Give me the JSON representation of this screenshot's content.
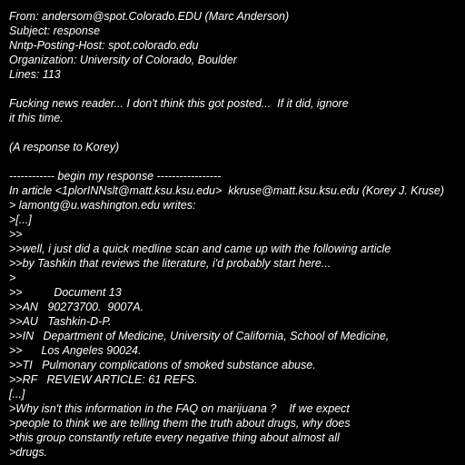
{
  "header": {
    "from": "From: andersom@spot.Colorado.EDU (Marc Anderson)",
    "subject": "Subject: response",
    "nntp_host": "Nntp-Posting-Host: spot.colorado.edu",
    "organization": "Organization: University of Colorado, Boulder",
    "lines": "Lines: 113"
  },
  "body": {
    "intro_1": "Fucking news reader... I don't think this got posted...  If it did, ignore",
    "intro_2": "it this time.",
    "intro_3": "(A response to Korey)",
    "begin": "------------ begin my response -----------------",
    "article": "In article <1plorINNslt@matt.ksu.ksu.edu>  kkruse@matt.ksu.ksu.edu (Korey J. Kruse)",
    "writes": "> lamontg@u.washington.edu writes:",
    "q1": ">[...]",
    "q2": ">>",
    "q3": ">>well, i just did a quick medline scan and came up with the following article",
    "q4": ">>by Tashkin that reviews the literature, i'd probably start here...",
    "q5": ">",
    "q6": ">>          Document 13",
    "q7": ">>AN   90273700.  9007A.",
    "q8": ">>AU   Tashkin-D-P.",
    "q9": ">>IN   Department of Medicine, University of California, School of Medicine,",
    "q10": ">>      Los Angeles 90024.",
    "q11": ">>TI   Pulmonary complications of smoked substance abuse.",
    "q12": ">>RF   REVIEW ARTICLE: 61 REFS.",
    "q13": "[...]",
    "q14": ">Why isn't this information in the FAQ on marijuana ?    If we expect",
    "q15": ">people to think we are telling them the truth about drugs, why does",
    "q16": ">this group constantly refute every negative thing about almost all",
    "q17": ">drugs."
  }
}
